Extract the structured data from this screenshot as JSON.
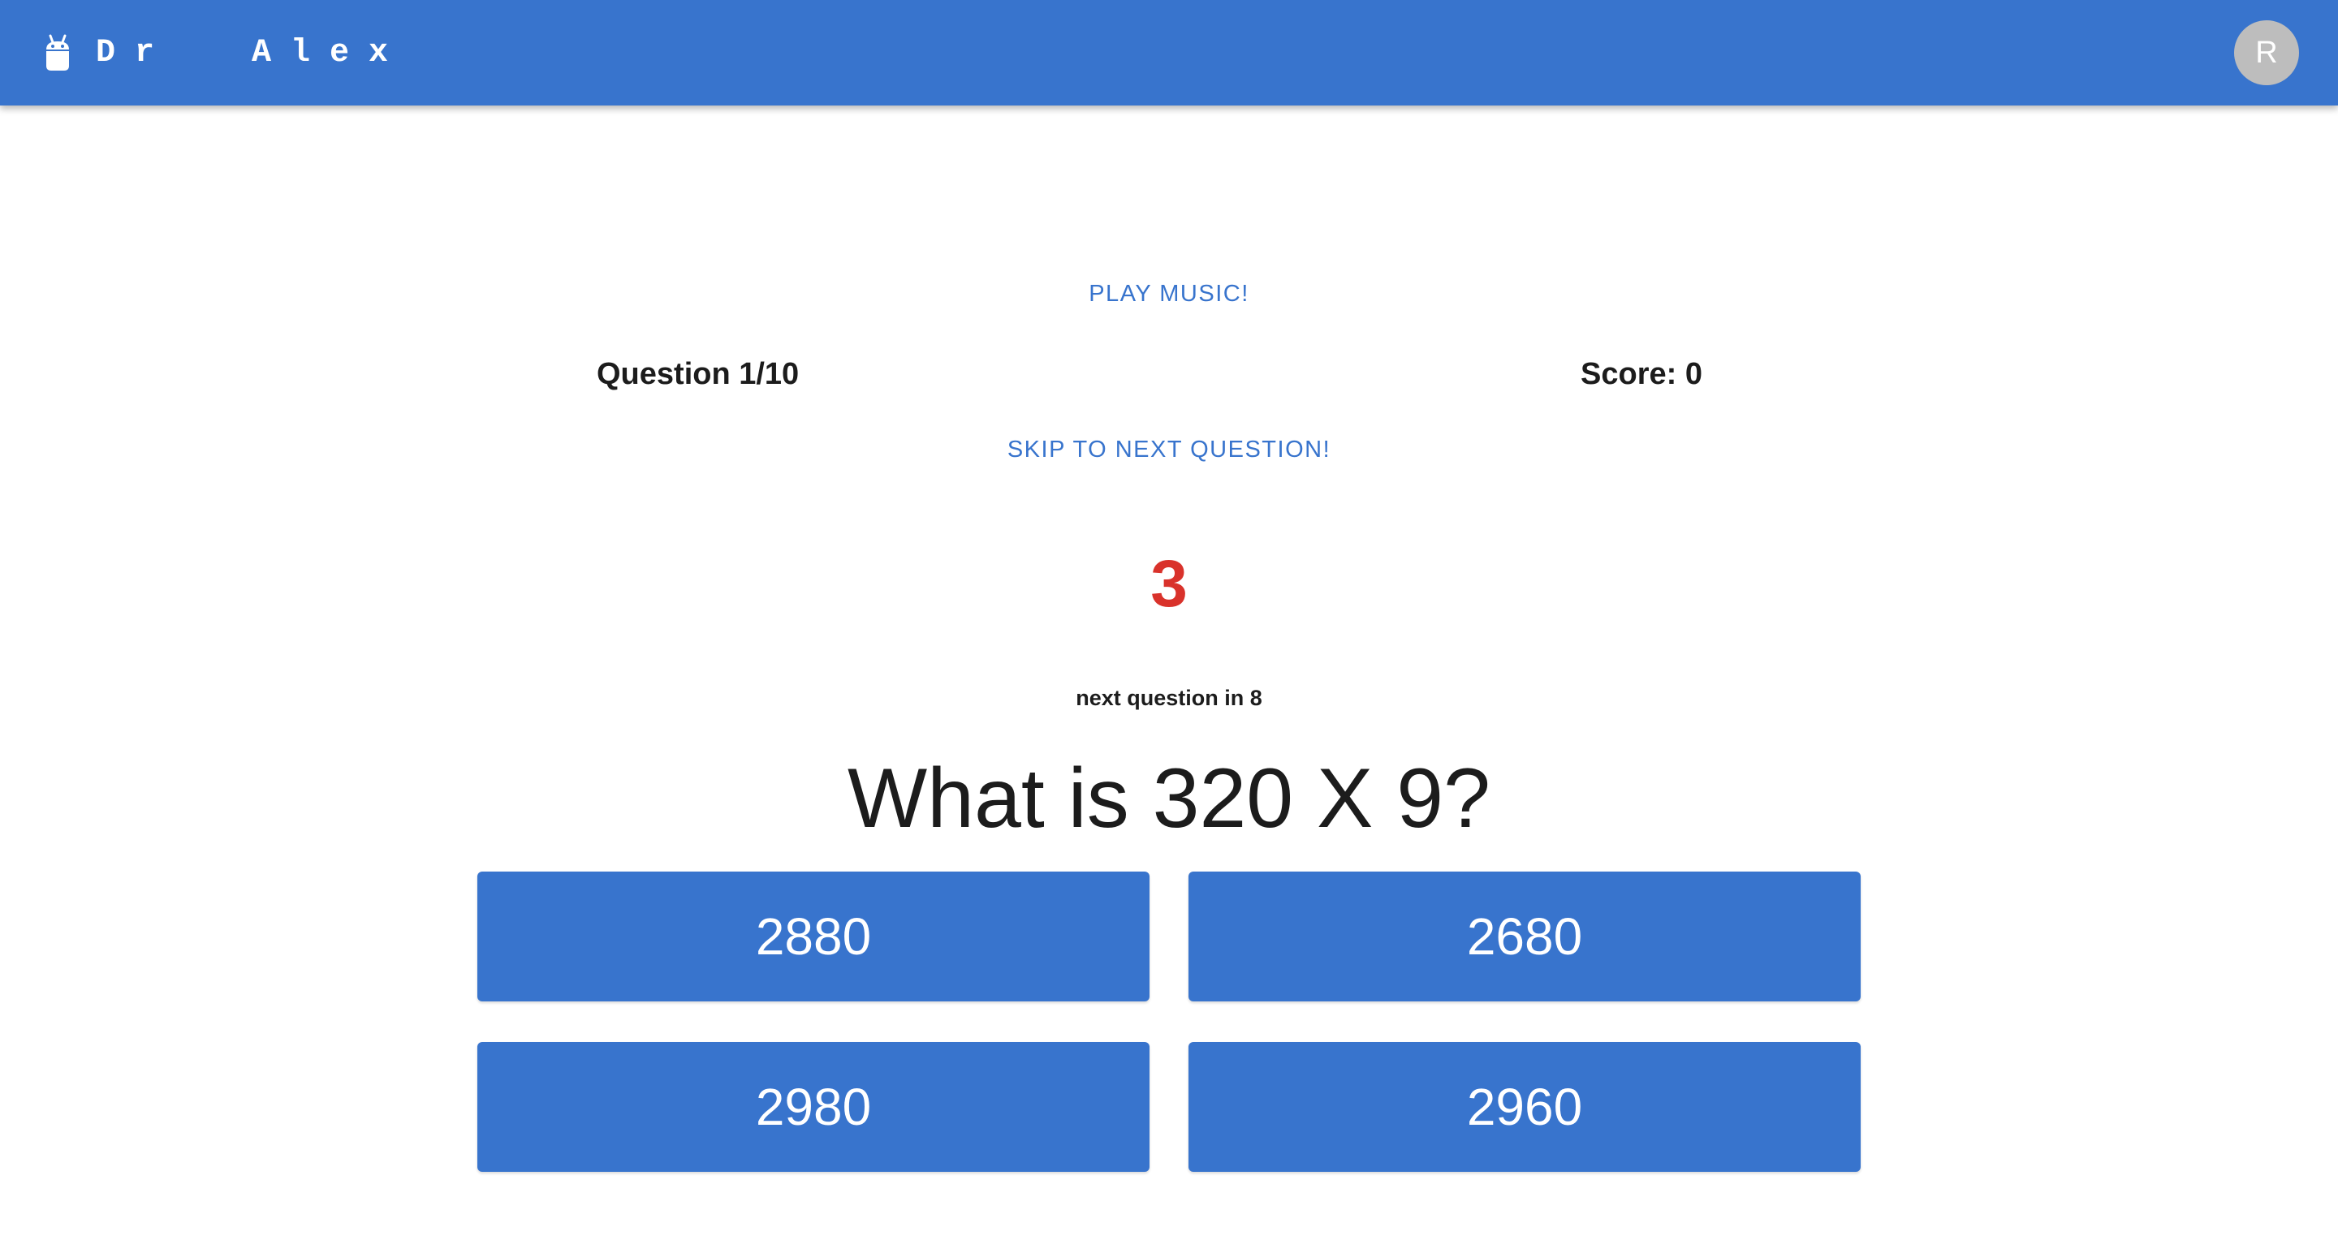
{
  "header": {
    "title": "Dr  Alex",
    "logo_icon": "robot-icon",
    "avatar_initial": "R"
  },
  "controls": {
    "play_music_label": "PLAY MUSIC!",
    "skip_label": "SKIP TO NEXT QUESTION!"
  },
  "status": {
    "question_counter": "Question 1/10",
    "score": "Score: 0"
  },
  "timer": {
    "countdown": "3",
    "next_question_text": "next question in 8"
  },
  "question": {
    "text": "What is 320 X 9?"
  },
  "answers": [
    {
      "label": "2880"
    },
    {
      "label": "2680"
    },
    {
      "label": "2980"
    },
    {
      "label": "2960"
    }
  ],
  "colors": {
    "primary": "#3874cd",
    "countdown": "#d9322b",
    "avatar_bg": "#bdbdbd"
  }
}
